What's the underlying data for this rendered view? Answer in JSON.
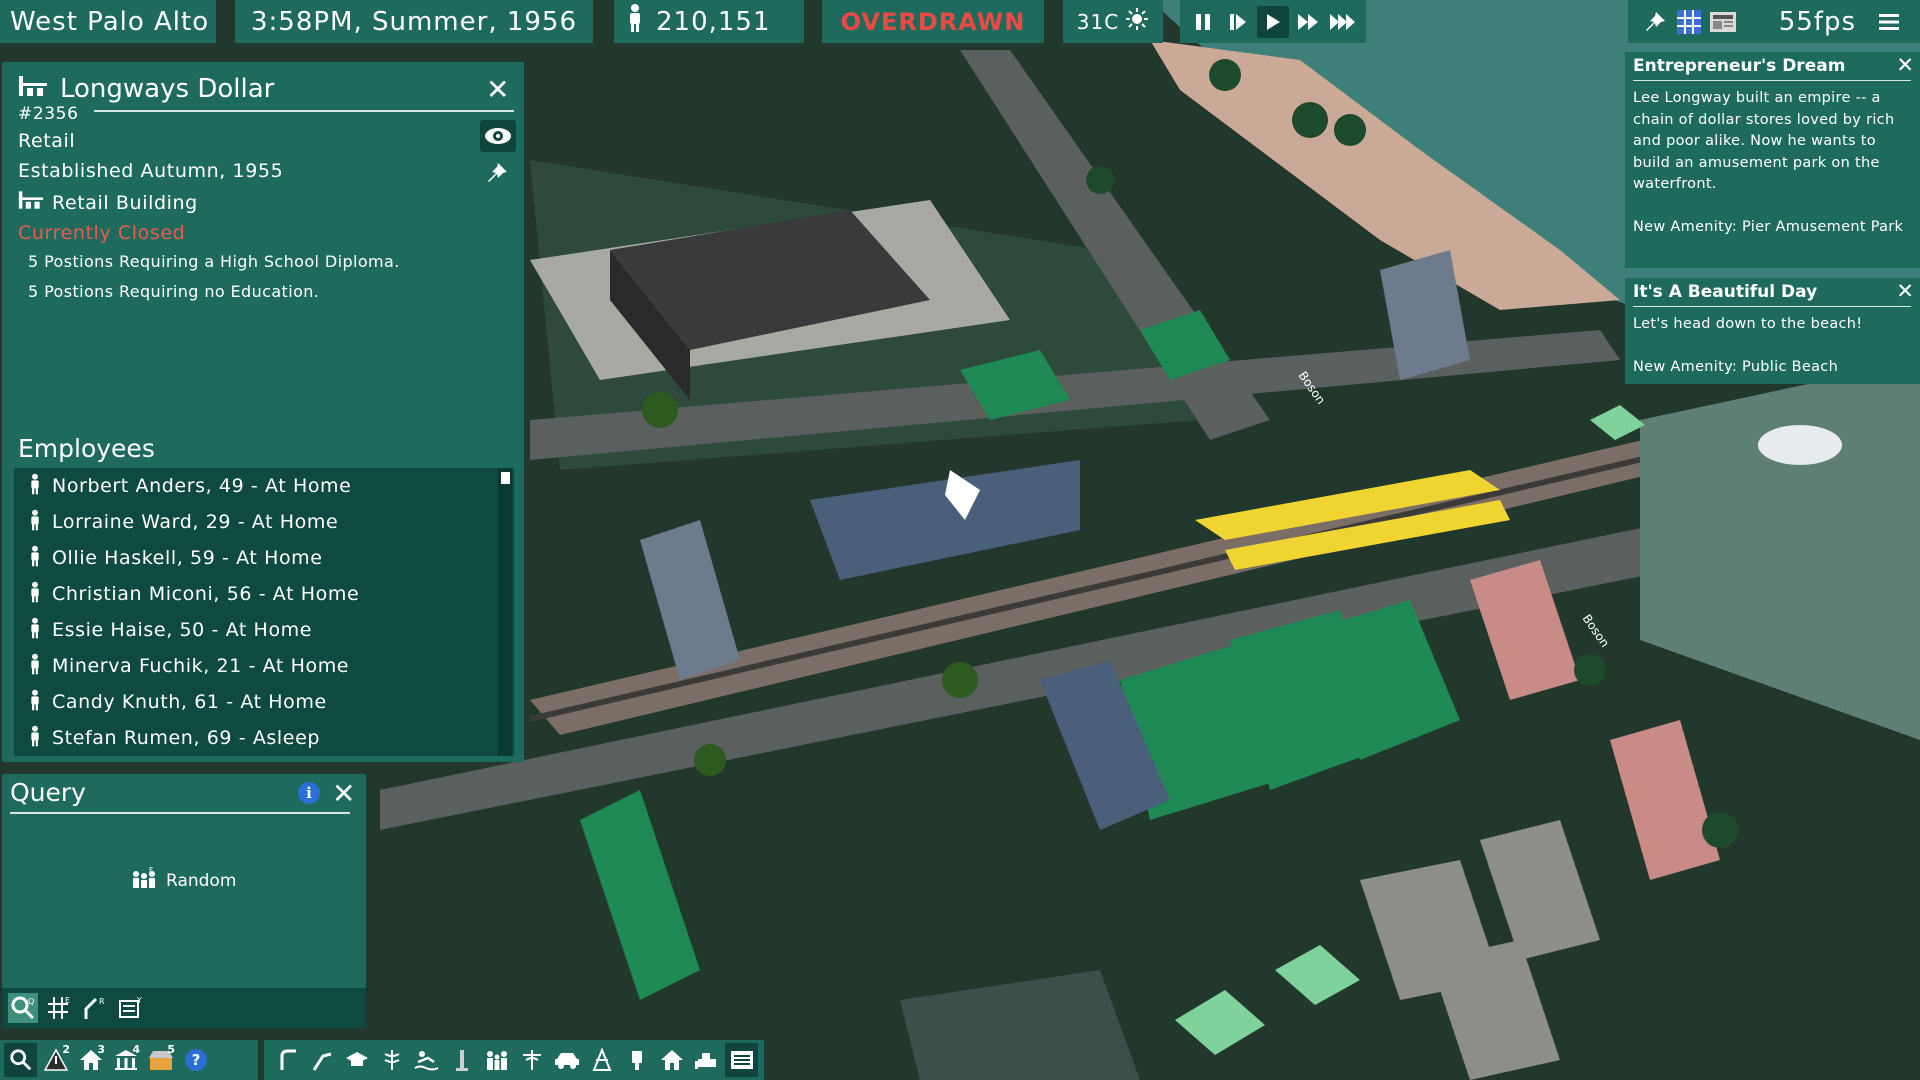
{
  "top_bar": {
    "city": "West Palo Alto",
    "datetime": "3:58PM, Summer, 1956",
    "population": "210,151",
    "money_status": "OVERDRAWN",
    "temperature": "31C",
    "fps": "55fps"
  },
  "building_panel": {
    "name": "Longways Dollar",
    "id": "#2356",
    "category": "Retail",
    "established": "Established Autumn, 1955",
    "building_type": "Retail Building",
    "status": "Currently Closed",
    "positions": [
      "5 Postions Requiring a High School Diploma.",
      "5 Postions Requiring no Education."
    ],
    "employees_heading": "Employees",
    "employees": [
      "Norbert Anders, 49 - At Home",
      "Lorraine Ward, 29 - At Home",
      "Ollie Haskell, 59 - At Home",
      "Christian Miconi, 56 - At Home",
      "Essie Haise, 50 - At Home",
      "Minerva Fuchik, 21 - At Home",
      "Candy Knuth, 61 - At Home",
      "Stefan Rumen, 69 - Asleep"
    ]
  },
  "query_panel": {
    "title": "Query",
    "random_label": "Random",
    "tool_letters": [
      "Q",
      "E",
      "R",
      "Y"
    ]
  },
  "bottom_toolbar": {
    "badges": [
      "2",
      "3",
      "4",
      "5"
    ]
  },
  "notifications": [
    {
      "title": "Entrepreneur's Dream",
      "body": "Lee Longway built an empire -- a chain of dollar stores loved by rich and poor alike. Now he wants to build an amusement park on the waterfront.",
      "amenity": "New Amenity: Pier Amusement Park"
    },
    {
      "title": "It's A Beautiful Day",
      "body": "Let's head down to the beach!",
      "amenity": "New Amenity: Public Beach"
    }
  ],
  "map_labels": [
    "Boson",
    "Boson"
  ],
  "colors": {
    "panel": "#1e6b5e",
    "panel_dark": "#0e4a40",
    "alert_red": "#e94a43",
    "status_closed": "#ec5a4c",
    "info_blue": "#2a6fd6"
  }
}
